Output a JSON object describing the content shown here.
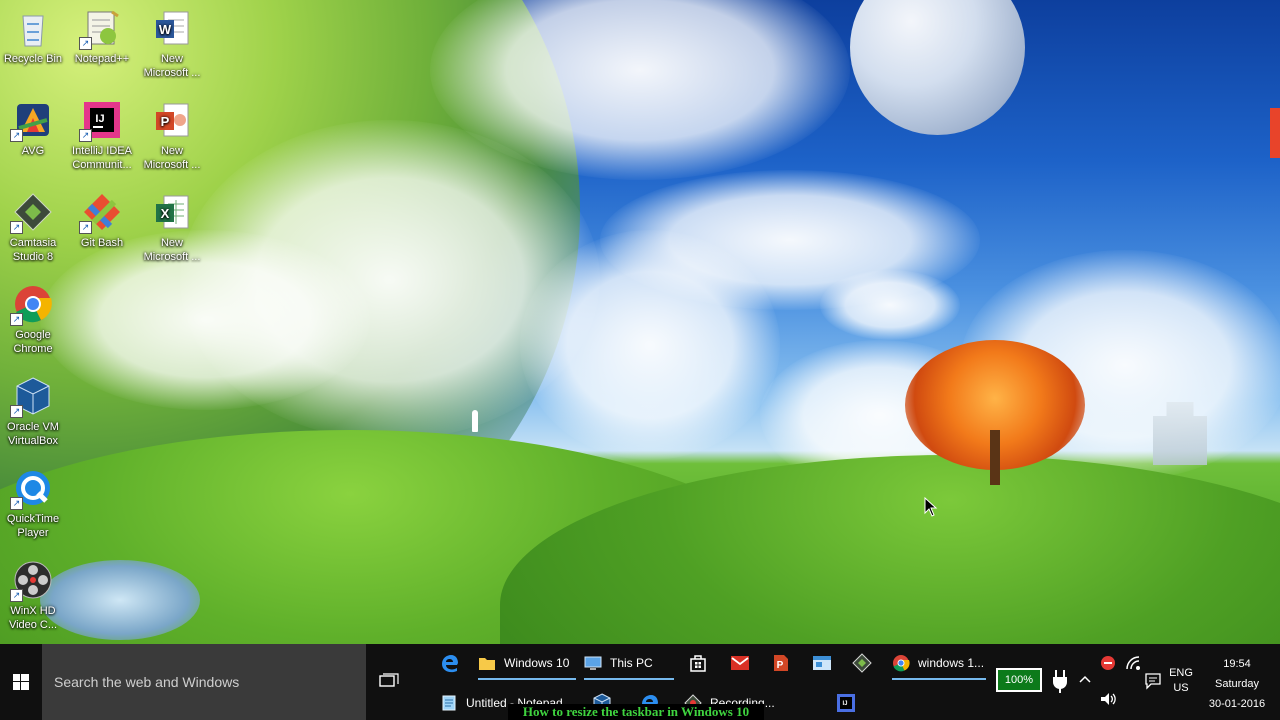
{
  "desktop": {
    "icons": [
      {
        "label": "Recycle Bin",
        "icon": "recycle-bin-icon"
      },
      {
        "label": "Notepad++",
        "icon": "notepad-plus-plus-icon"
      },
      {
        "label": "New Microsoft ...",
        "icon": "word-document-icon"
      },
      {
        "label": "AVG",
        "icon": "avg-icon"
      },
      {
        "label": "IntelliJ IDEA Communit...",
        "icon": "intellij-idea-icon"
      },
      {
        "label": "New Microsoft ...",
        "icon": "powerpoint-document-icon"
      },
      {
        "label": "Camtasia Studio 8",
        "icon": "camtasia-icon"
      },
      {
        "label": "Git Bash",
        "icon": "git-bash-icon"
      },
      {
        "label": "New Microsoft ...",
        "icon": "excel-document-icon"
      },
      {
        "label": "Google Chrome",
        "icon": "chrome-icon"
      },
      {
        "label": "Oracle VM VirtualBox",
        "icon": "virtualbox-icon"
      },
      {
        "label": "QuickTime Player",
        "icon": "quicktime-icon"
      },
      {
        "label": "WinX HD Video C...",
        "icon": "winx-video-icon"
      }
    ]
  },
  "taskbar": {
    "search_placeholder": "Search the web and Windows",
    "row1": [
      {
        "label": "",
        "icon": "edge-icon"
      },
      {
        "label": "Windows 10",
        "icon": "folder-icon"
      },
      {
        "label": "This PC",
        "icon": "this-pc-icon"
      },
      {
        "label": "",
        "icon": "store-icon"
      },
      {
        "label": "",
        "icon": "mail-icon"
      },
      {
        "label": "",
        "icon": "powerpoint-icon"
      },
      {
        "label": "",
        "icon": "window-app-icon"
      },
      {
        "label": "",
        "icon": "camtasia-icon"
      },
      {
        "label": "windows 1...",
        "icon": "chrome-icon"
      }
    ],
    "row2": [
      {
        "label": "Untitled - Notepad",
        "icon": "notepad-icon"
      },
      {
        "label": "",
        "icon": "virtualbox-icon"
      },
      {
        "label": "",
        "icon": "edge-icon"
      },
      {
        "label": "Recording...",
        "icon": "recording-icon"
      },
      {
        "label": "",
        "icon": "intellij-idea-icon"
      }
    ],
    "battery": "100%",
    "language": {
      "line1": "ENG",
      "line2": "US"
    },
    "clock": {
      "time": "19:54",
      "day": "Saturday",
      "date": "30-01-2016"
    }
  },
  "caption": "How to resize the taskbar in Windows 10",
  "colors": {
    "taskbar_bg": "#101010",
    "search_bg": "#3a3a3a",
    "accent": "#76b9ed",
    "caption_text": "#3fd43f"
  }
}
